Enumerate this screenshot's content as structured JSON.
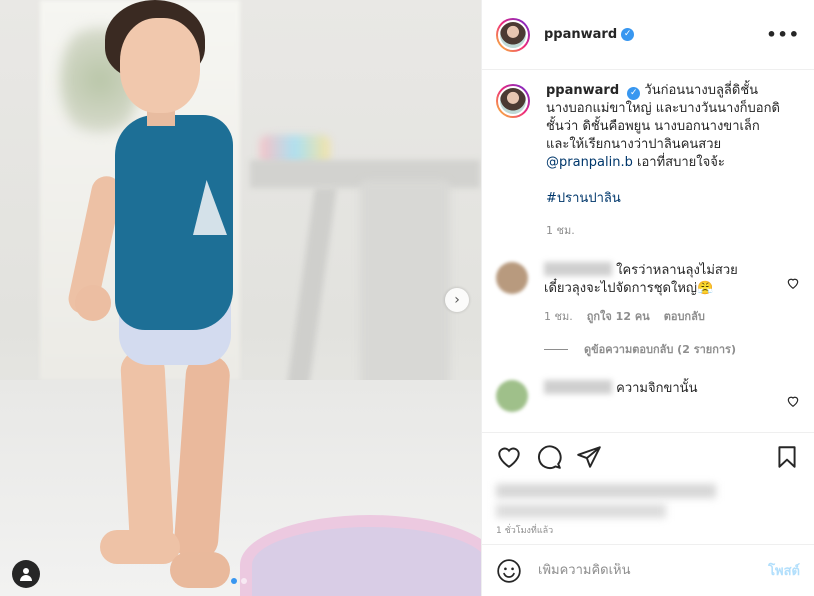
{
  "post": {
    "username": "ppanward",
    "verified": true,
    "more_icon": "more-options-icon",
    "caption": {
      "username": "ppanward",
      "text": "วันก่อนนางบลูลี่ดิชั้น นางบอกแม่ขาใหญ่ และบางวันนางก็บอกดิชั้นว่า ดิชั้นคือพยูน นางบอกนางขาเล็ก และให้เรียกนางว่าปาลินคนสวย",
      "mention": "@pranpalin.b",
      "text_after": "เอาที่สบายใจจ้ะ",
      "hashtag": "#ปรานปาลิน",
      "time": "1 ชม."
    },
    "comments": [
      {
        "text": "ใครว่าหลานลุงไม่สวย เดี๋ยวลุงจะไปจัดการชุดใหญ่😤",
        "time": "1 ชม.",
        "likes": "ถูกใจ 12 คน",
        "reply": "ตอบกลับ",
        "view_replies": "ดูข้อความตอบกลับ (2 รายการ)",
        "avatar_color": "#b89a7e"
      },
      {
        "text": "ความจิกขานั้น",
        "avatar_color": "#9fc08a"
      }
    ],
    "posted": "1 ชั่วโมงที่แล้ว",
    "add_comment_placeholder": "เพิ่มความคิดเห็น",
    "post_button": "โพสต์"
  },
  "media": {
    "slide_index": 1,
    "slide_count": 2
  },
  "colors": {
    "link": "#00376b",
    "verified": "#3897f0",
    "post_button_disabled": "#b2dffc"
  }
}
